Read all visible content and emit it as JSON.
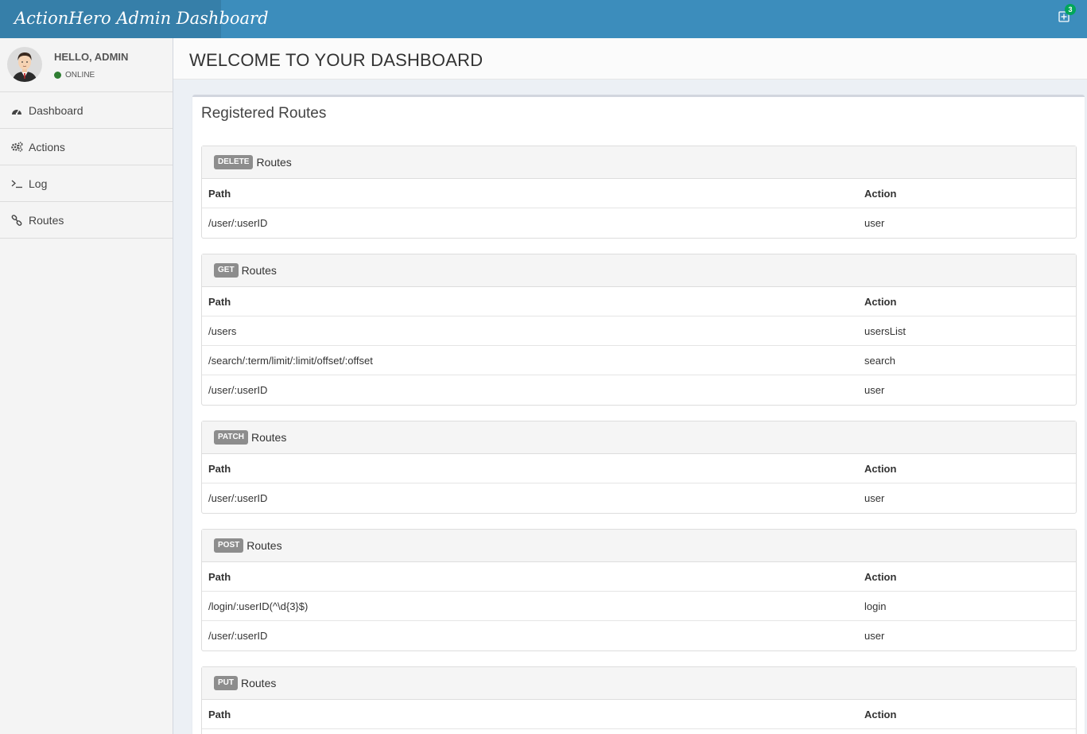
{
  "header": {
    "brand": "ActionHero Admin Dashboard",
    "notification_count": "3"
  },
  "sidebar": {
    "user_greeting": "HELLO, ADMIN",
    "user_status": "ONLINE",
    "items": [
      {
        "label": "Dashboard",
        "icon": "dashboard-icon"
      },
      {
        "label": "Actions",
        "icon": "gears-icon"
      },
      {
        "label": "Log",
        "icon": "terminal-icon"
      },
      {
        "label": "Routes",
        "icon": "link-icon"
      }
    ]
  },
  "page": {
    "title": "WELCOME TO YOUR DASHBOARD",
    "box_title": "Registered Routes"
  },
  "routes": {
    "panel_suffix": "Routes",
    "col_path": "Path",
    "col_action": "Action",
    "groups": [
      {
        "method": "DELETE",
        "rows": [
          {
            "path": "/user/:userID",
            "action": "user"
          }
        ]
      },
      {
        "method": "GET",
        "rows": [
          {
            "path": "/users",
            "action": "usersList"
          },
          {
            "path": "/search/:term/limit/:limit/offset/:offset",
            "action": "search"
          },
          {
            "path": "/user/:userID",
            "action": "user"
          }
        ]
      },
      {
        "method": "PATCH",
        "rows": [
          {
            "path": "/user/:userID",
            "action": "user"
          }
        ]
      },
      {
        "method": "POST",
        "rows": [
          {
            "path": "/login/:userID(^\\d{3}$)",
            "action": "login"
          },
          {
            "path": "/user/:userID",
            "action": "user"
          }
        ]
      },
      {
        "method": "PUT",
        "rows": []
      }
    ]
  }
}
